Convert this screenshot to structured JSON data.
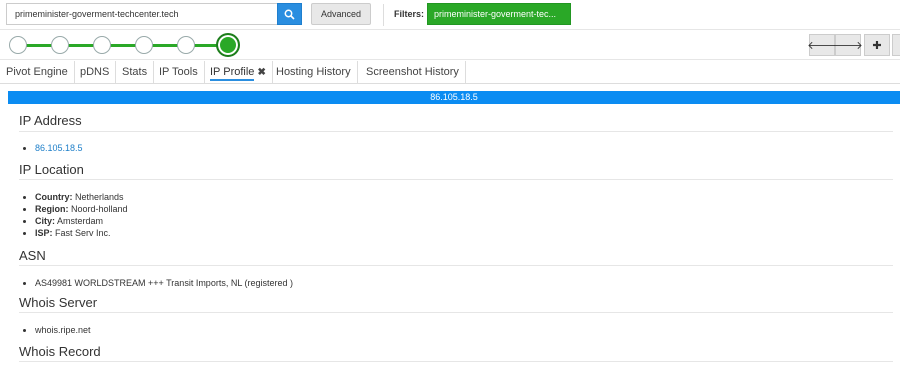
{
  "search": {
    "value": "primeminister-goverment-techcenter.tech"
  },
  "advanced_label": "Advanced",
  "filters": {
    "label": "Filters:",
    "chip": "primeminister-goverment-tec..."
  },
  "tabs": [
    {
      "label": "Pivot Engine"
    },
    {
      "label": "pDNS"
    },
    {
      "label": "Stats"
    },
    {
      "label": "IP Tools"
    },
    {
      "label": "IP Profile",
      "close": "✖"
    },
    {
      "label": "Hosting History"
    },
    {
      "label": "Screenshot History"
    }
  ],
  "nav": {
    "back": "🡐",
    "forward": "🡒",
    "add": "✚"
  },
  "ip_bar": "86.105.18.5",
  "sections": {
    "ip_address": {
      "title": "IP Address",
      "value": "86.105.18.5"
    },
    "ip_location": {
      "title": "IP Location",
      "country_label": "Country:",
      "country": "Netherlands",
      "region_label": "Region:",
      "region": "Noord-holland",
      "city_label": "City:",
      "city": "Amsterdam",
      "isp_label": "ISP:",
      "isp": "Fast Serv Inc."
    },
    "asn": {
      "title": "ASN",
      "value": "AS49981 WORLDSTREAM +++ Transit Imports, NL (registered )"
    },
    "whois_server": {
      "title": "Whois Server",
      "value": "whois.ripe.net"
    },
    "whois_record": {
      "title": "Whois Record"
    }
  },
  "colors": {
    "accent": "#0b8cf2",
    "filter_green": "#2aa827",
    "link": "#1e7fc9"
  }
}
